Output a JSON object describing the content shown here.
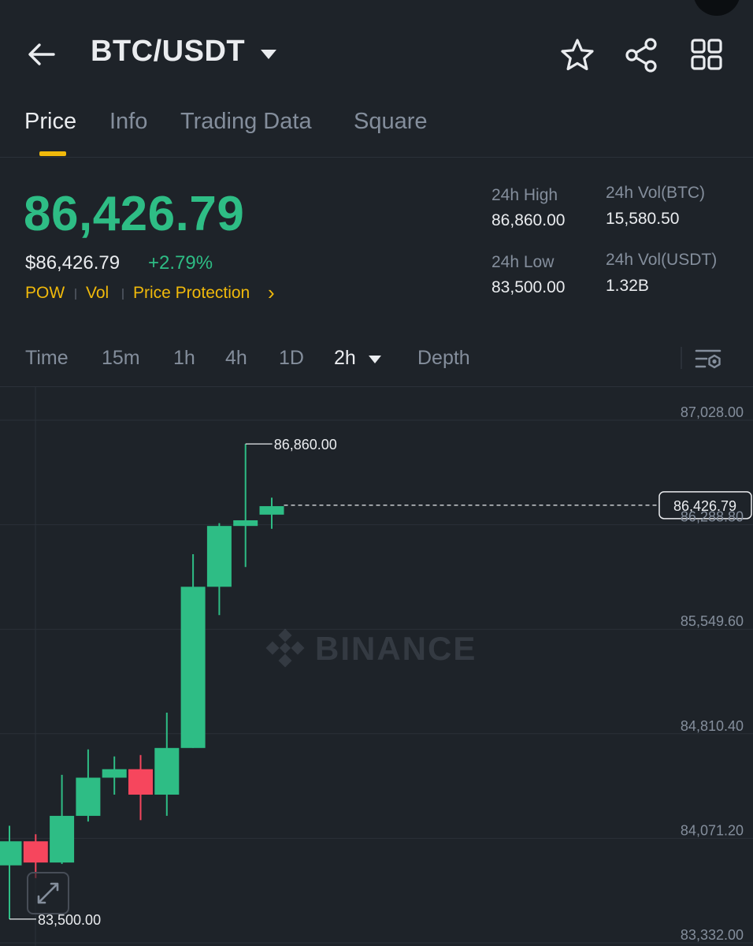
{
  "header": {
    "pair": "BTC/USDT",
    "icons": {
      "back": "arrow-left-icon",
      "pair_menu": "caret-down-icon",
      "favorite": "star-icon",
      "share": "share-icon",
      "more": "grid-icon"
    }
  },
  "tabs": [
    {
      "label": "Price",
      "active": true
    },
    {
      "label": "Info",
      "active": false
    },
    {
      "label": "Trading Data",
      "active": false
    },
    {
      "label": "Square",
      "active": false
    }
  ],
  "ticker": {
    "last_price": "86,426.79",
    "fiat_price": "$86,426.79",
    "change_pct": "+2.79%",
    "tags": [
      "POW",
      "Vol",
      "Price Protection"
    ],
    "tag_chevron": "›",
    "stats": {
      "high_label": "24h High",
      "high_value": "86,860.00",
      "low_label": "24h Low",
      "low_value": "83,500.00",
      "vol_base_label": "24h Vol(BTC)",
      "vol_base_value": "15,580.50",
      "vol_quote_label": "24h Vol(USDT)",
      "vol_quote_value": "1.32B"
    }
  },
  "timeframes": [
    {
      "label": "Time",
      "active": false
    },
    {
      "label": "15m",
      "active": false
    },
    {
      "label": "1h",
      "active": false
    },
    {
      "label": "4h",
      "active": false
    },
    {
      "label": "1D",
      "active": false
    },
    {
      "label": "2h",
      "active": true
    },
    {
      "label": "Depth",
      "active": false
    }
  ],
  "colors": {
    "up": "#2ebd85",
    "down": "#f6465d",
    "accent": "#f0b90b",
    "background": "#1e2329",
    "grid": "#2b3139",
    "muted": "#848e9c"
  },
  "watermark": "BINANCE",
  "chart_data": {
    "type": "candlestick",
    "interval": "2h",
    "y_ticks": [
      87028.0,
      86288.8,
      85549.6,
      84810.4,
      84071.2,
      83332.0
    ],
    "y_tick_labels": [
      "87,028.00",
      "86,288.80",
      "85,549.60",
      "84,810.40",
      "84,071.20",
      "83,332.00"
    ],
    "ylim": [
      83332.0,
      87028.0
    ],
    "current_price": 86426.79,
    "current_price_label": "86,426.79",
    "max_marker": {
      "index": 9,
      "value": 86860.0,
      "label": "86,860.00"
    },
    "min_marker": {
      "index": 0,
      "value": 83500.0,
      "label": "83,500.00"
    },
    "candles": [
      {
        "open": 83880,
        "high": 84160,
        "low": 83500,
        "close": 84050
      },
      {
        "open": 84050,
        "high": 84100,
        "low": 83790,
        "close": 83900
      },
      {
        "open": 83900,
        "high": 84520,
        "low": 83890,
        "close": 84230
      },
      {
        "open": 84230,
        "high": 84700,
        "low": 84190,
        "close": 84500
      },
      {
        "open": 84500,
        "high": 84650,
        "low": 84380,
        "close": 84560
      },
      {
        "open": 84560,
        "high": 84660,
        "low": 84200,
        "close": 84380
      },
      {
        "open": 84380,
        "high": 84960,
        "low": 84230,
        "close": 84710
      },
      {
        "open": 84710,
        "high": 86080,
        "low": 84710,
        "close": 85850
      },
      {
        "open": 85850,
        "high": 86300,
        "low": 85650,
        "close": 86280
      },
      {
        "open": 86280,
        "high": 86860,
        "low": 85990,
        "close": 86320
      },
      {
        "open": 86360,
        "high": 86480,
        "low": 86260,
        "close": 86420
      }
    ]
  }
}
